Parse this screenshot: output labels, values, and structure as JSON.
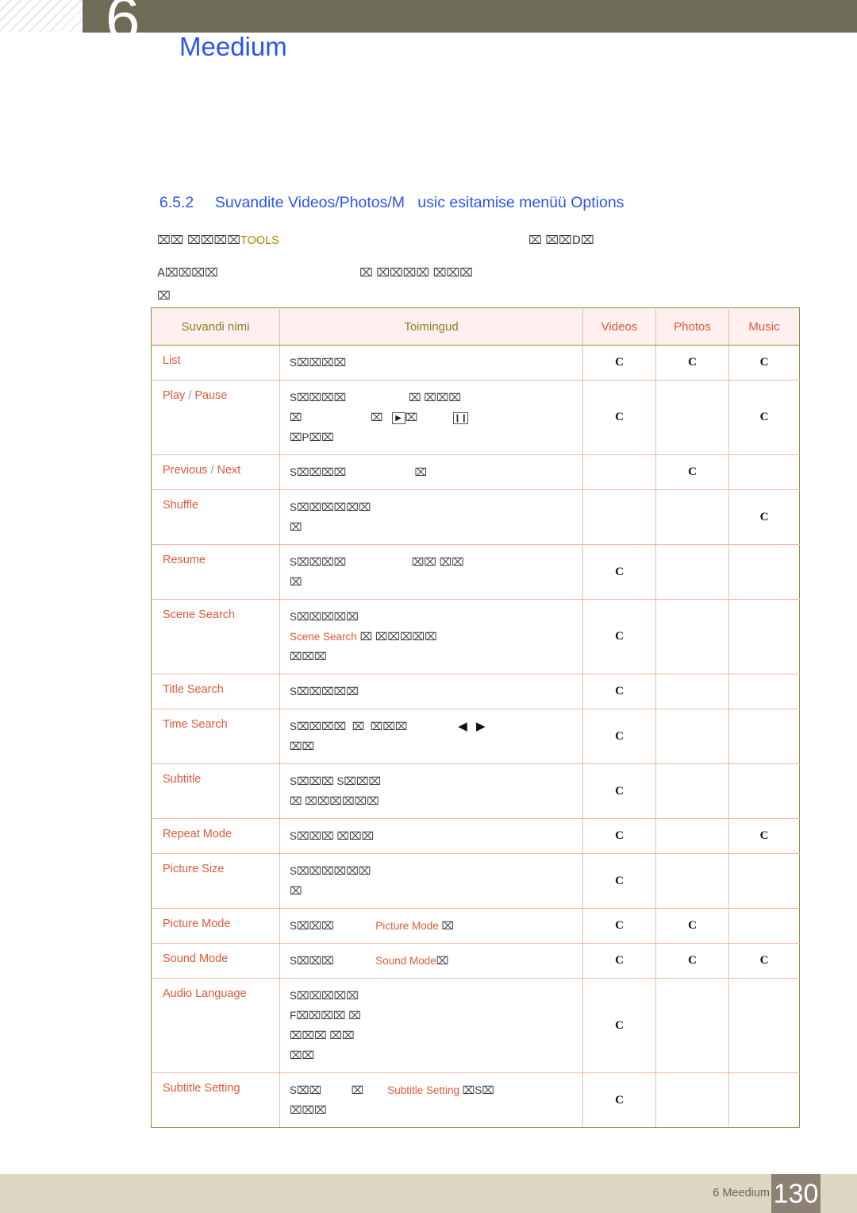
{
  "header": {
    "chapter_number": "6",
    "chapter_title": "Meedium"
  },
  "section": {
    "number": "6.5.2",
    "title": "Suvandite Videos/Photos/M   usic esitamise menüü Options"
  },
  "intro": {
    "line1_prefix": "⌧⌧ ⌧⌧⌧⌧",
    "line1_tools": "TOOLS",
    "line1_right": "⌧ ⌧⌧D⌧",
    "line2": "A⌧⌧⌧⌧",
    "line2_right": "⌧ ⌧⌧⌧⌧ ⌧⌧⌧",
    "line3": "⌧"
  },
  "table": {
    "columns": [
      "Suvandi nimi",
      "Toimingud",
      "Videos",
      "Photos",
      "Music"
    ],
    "rows": [
      {
        "name": "List",
        "name_parts": [
          "List"
        ],
        "action_lines": [
          [
            {
              "t": "S⌧⌧⌧⌧",
              "hl": false
            }
          ]
        ],
        "videos": "C",
        "photos": "C",
        "music": "C"
      },
      {
        "name": "Play / Pause",
        "name_parts": [
          "Play",
          " / ",
          "Pause"
        ],
        "action_lines": [
          [
            {
              "t": "S⌧⌧⌧⌧                     ⌧ ⌧⌧⌧",
              "hl": false
            }
          ],
          [
            {
              "t": "⌧                       ⌧   ",
              "hl": false
            },
            {
              "icon": "▶"
            },
            {
              "t": "⌧            ",
              "hl": false
            },
            {
              "icon": "❙❙"
            }
          ],
          [
            {
              "t": "⌧P⌧⌧",
              "hl": false
            }
          ]
        ],
        "videos": "C",
        "photos": "",
        "music": "C"
      },
      {
        "name": "Previous / Next",
        "name_parts": [
          "Previous",
          " / ",
          "Next"
        ],
        "action_lines": [
          [
            {
              "t": "S⌧⌧⌧⌧                       ⌧",
              "hl": false
            }
          ]
        ],
        "videos": "",
        "photos": "C",
        "music": ""
      },
      {
        "name": "Shuffle",
        "name_parts": [
          "Shuffle"
        ],
        "action_lines": [
          [
            {
              "t": "S⌧⌧⌧⌧⌧⌧",
              "hl": false
            }
          ],
          [
            {
              "t": "⌧",
              "hl": false
            }
          ]
        ],
        "videos": "",
        "photos": "",
        "music": "C"
      },
      {
        "name": "Resume",
        "name_parts": [
          "Resume"
        ],
        "action_lines": [
          [
            {
              "t": "S⌧⌧⌧⌧                      ⌧⌧ ⌧⌧",
              "hl": false
            }
          ],
          [
            {
              "t": "⌧",
              "hl": false
            }
          ]
        ],
        "videos": "C",
        "photos": "",
        "music": ""
      },
      {
        "name": "Scene Search",
        "name_parts": [
          "Scene Search"
        ],
        "action_lines": [
          [
            {
              "t": "S⌧⌧⌧⌧⌧",
              "hl": false
            }
          ],
          [
            {
              "t": "Scene Search ",
              "hl": true
            },
            {
              "t": "⌧ ⌧⌧⌧⌧⌧",
              "hl": false
            }
          ],
          [
            {
              "t": "⌧⌧⌧",
              "hl": false
            }
          ]
        ],
        "videos": "C",
        "photos": "",
        "music": ""
      },
      {
        "name": "Title Search",
        "name_parts": [
          "Title Search"
        ],
        "action_lines": [
          [
            {
              "t": "S⌧⌧⌧⌧⌧",
              "hl": false
            }
          ]
        ],
        "videos": "C",
        "photos": "",
        "music": ""
      },
      {
        "name": "Time Search",
        "name_parts": [
          "Time Search"
        ],
        "action_lines": [
          [
            {
              "t": "S⌧⌧⌧⌧  ⌧  ⌧⌧⌧                 ",
              "hl": false
            },
            {
              "tri": "◀"
            },
            {
              "t": "   ",
              "hl": false
            },
            {
              "tri": "▶"
            }
          ],
          [
            {
              "t": "⌧⌧",
              "hl": false
            }
          ]
        ],
        "videos": "C",
        "photos": "",
        "music": ""
      },
      {
        "name": "Subtitle",
        "name_parts": [
          "Subtitle"
        ],
        "action_lines": [
          [
            {
              "t": "S⌧⌧⌧ S⌧⌧⌧",
              "hl": false
            }
          ],
          [
            {
              "t": "⌧ ⌧⌧⌧⌧⌧⌧",
              "hl": false
            }
          ]
        ],
        "videos": "C",
        "photos": "",
        "music": ""
      },
      {
        "name": "Repeat Mode",
        "name_parts": [
          "Repeat Mode"
        ],
        "action_lines": [
          [
            {
              "t": "S⌧⌧⌧ ⌧⌧⌧",
              "hl": false
            }
          ]
        ],
        "videos": "C",
        "photos": "",
        "music": "C"
      },
      {
        "name": "Picture Size",
        "name_parts": [
          "Picture Size"
        ],
        "action_lines": [
          [
            {
              "t": "S⌧⌧⌧⌧⌧⌧",
              "hl": false
            }
          ],
          [
            {
              "t": "⌧",
              "hl": false
            }
          ]
        ],
        "videos": "C",
        "photos": "",
        "music": ""
      },
      {
        "name": "Picture Mode",
        "name_parts": [
          "Picture Mode"
        ],
        "action_lines": [
          [
            {
              "t": "S⌧⌧⌧              ",
              "hl": false
            },
            {
              "t": "Picture Mode ",
              "hl": true
            },
            {
              "t": "⌧",
              "hl": false
            }
          ]
        ],
        "videos": "C",
        "photos": "C",
        "music": ""
      },
      {
        "name": "Sound Mode",
        "name_parts": [
          "Sound Mode"
        ],
        "action_lines": [
          [
            {
              "t": "S⌧⌧⌧              ",
              "hl": false
            },
            {
              "t": "Sound Mode",
              "hl": true
            },
            {
              "t": "⌧",
              "hl": false
            }
          ]
        ],
        "videos": "C",
        "photos": "C",
        "music": "C"
      },
      {
        "name": "Audio Language",
        "name_parts": [
          "Audio Language"
        ],
        "action_lines": [
          [
            {
              "t": "S⌧⌧⌧⌧⌧",
              "hl": false
            }
          ],
          [
            {
              "t": "F⌧⌧⌧⌧ ⌧",
              "hl": false
            }
          ],
          [
            {
              "t": "⌧⌧⌧ ⌧⌧",
              "hl": false
            }
          ],
          [
            {
              "t": "⌧⌧",
              "hl": false
            }
          ]
        ],
        "videos": "C",
        "photos": "",
        "music": ""
      },
      {
        "name": "Subtitle Setting",
        "name_parts": [
          "Subtitle Setting"
        ],
        "action_lines": [
          [
            {
              "t": "S⌧⌧          ⌧        ",
              "hl": false
            },
            {
              "t": "Subtitle Setting ",
              "hl": true
            },
            {
              "t": "⌧S⌧",
              "hl": false
            }
          ],
          [
            {
              "t": "⌧⌧⌧",
              "hl": false
            }
          ]
        ],
        "videos": "C",
        "photos": "",
        "music": ""
      }
    ]
  },
  "footer": {
    "label": "6 Meedium",
    "page": "130"
  },
  "colors": {
    "accent_blue": "#2b55ef",
    "accent_orange": "#e2593a",
    "header_olive": "#6e6b56",
    "table_header_bg": "#fdf0ee",
    "table_border": "#f0b9a0",
    "footer_bg": "#dcd6c2",
    "page_box": "#8c8173",
    "tools_gold": "#b08700"
  }
}
